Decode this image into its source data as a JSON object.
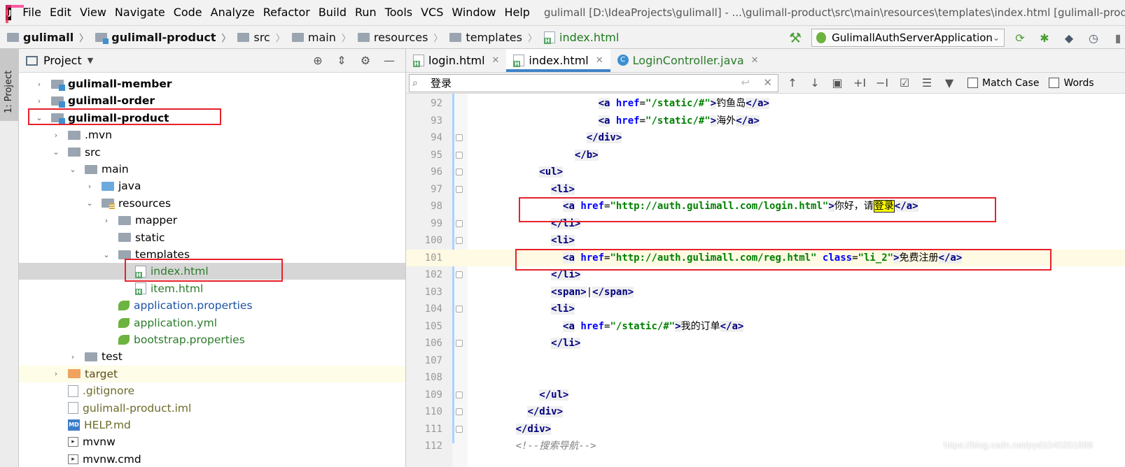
{
  "menu": {
    "items": [
      "File",
      "Edit",
      "View",
      "Navigate",
      "Code",
      "Analyze",
      "Refactor",
      "Build",
      "Run",
      "Tools",
      "VCS",
      "Window",
      "Help"
    ],
    "window_title": "gulimall [D:\\IdeaProjects\\gulimall] - ...\\gulimall-product\\src\\main\\resources\\templates\\index.html [gulimall-produ"
  },
  "breadcrumb": [
    "gulimall",
    "gulimall-product",
    "src",
    "main",
    "resources",
    "templates",
    "index.html"
  ],
  "run_config": "GulimallAuthServerApplication",
  "left_strip": {
    "project_tab": "1: Project"
  },
  "project_panel": {
    "title": "Project",
    "tree": [
      {
        "label": "gulimall-member",
        "arrow": "›",
        "icon": "module-folder"
      },
      {
        "label": "gulimall-order",
        "arrow": "›",
        "icon": "module-folder"
      },
      {
        "label": "gulimall-product",
        "arrow": "⌄",
        "icon": "module-folder"
      },
      {
        "label": ".mvn",
        "arrow": "›",
        "icon": "folder"
      },
      {
        "label": "src",
        "arrow": "⌄",
        "icon": "folder"
      },
      {
        "label": "main",
        "arrow": "⌄",
        "icon": "folder"
      },
      {
        "label": "java",
        "arrow": "›",
        "icon": "source-folder"
      },
      {
        "label": "resources",
        "arrow": "⌄",
        "icon": "resources-folder"
      },
      {
        "label": "mapper",
        "arrow": "›",
        "icon": "folder"
      },
      {
        "label": "static",
        "arrow": "",
        "icon": "folder"
      },
      {
        "label": "templates",
        "arrow": "⌄",
        "icon": "folder"
      },
      {
        "label": "index.html",
        "arrow": "",
        "icon": "html-file"
      },
      {
        "label": "item.html",
        "arrow": "",
        "icon": "html-file"
      },
      {
        "label": "application.properties",
        "arrow": "",
        "icon": "spring-file"
      },
      {
        "label": "application.yml",
        "arrow": "",
        "icon": "spring-file"
      },
      {
        "label": "bootstrap.properties",
        "arrow": "",
        "icon": "spring-file"
      },
      {
        "label": "test",
        "arrow": "›",
        "icon": "folder"
      },
      {
        "label": "target",
        "arrow": "›",
        "icon": "excluded-folder"
      },
      {
        "label": ".gitignore",
        "arrow": "",
        "icon": "file"
      },
      {
        "label": "gulimall-product.iml",
        "arrow": "",
        "icon": "file"
      },
      {
        "label": "HELP.md",
        "arrow": "",
        "icon": "markdown-file"
      },
      {
        "label": "mvnw",
        "arrow": "",
        "icon": "terminal-file"
      },
      {
        "label": "mvnw.cmd",
        "arrow": "",
        "icon": "terminal-file"
      }
    ]
  },
  "editor": {
    "tabs": [
      {
        "label": "login.html",
        "icon": "html-file",
        "active": false
      },
      {
        "label": "index.html",
        "icon": "html-file",
        "active": true
      },
      {
        "label": "LoginController.java",
        "icon": "java-class",
        "active": false
      }
    ],
    "find": {
      "query": "登录",
      "match_case_label": "Match Case",
      "words_label": "Words",
      "match_case": false,
      "words": false
    },
    "lines": [
      {
        "no": "92"
      },
      {
        "no": "93"
      },
      {
        "no": "94"
      },
      {
        "no": "95"
      },
      {
        "no": "96"
      },
      {
        "no": "97"
      },
      {
        "no": "98"
      },
      {
        "no": "99"
      },
      {
        "no": "100"
      },
      {
        "no": "101"
      },
      {
        "no": "102"
      },
      {
        "no": "103"
      },
      {
        "no": "104"
      },
      {
        "no": "105"
      },
      {
        "no": "106"
      },
      {
        "no": "107"
      },
      {
        "no": "108"
      },
      {
        "no": "109"
      },
      {
        "no": "110"
      },
      {
        "no": "111"
      },
      {
        "no": "112"
      }
    ],
    "code_text": {
      "l92_text": "钓鱼岛",
      "l93_text": "海外",
      "l98_url": "\"http://auth.gulimall.com/login.html\"",
      "l98_text_pre": "你好，请",
      "l98_match": "登录",
      "l101_url": "\"http://auth.gulimall.com/reg.html\"",
      "l101_class_val": "\"li_2\"",
      "l101_text": "免费注册",
      "l103_sep": "|",
      "l105_text": "我的订单",
      "static_href": "\"/static/#\"",
      "l112_comment": "<!--搜索导航-->"
    }
  },
  "watermark": "https://blog.csdn.net/pyd1040201698",
  "colors": {
    "accent": "#4083c9",
    "highlight_box": "#e8212b",
    "find_match": "#ffff00"
  }
}
